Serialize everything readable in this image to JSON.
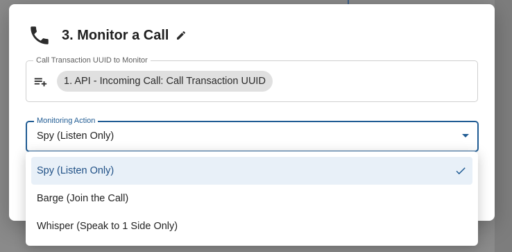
{
  "dialog": {
    "title": "3. Monitor a Call",
    "icons": {
      "header": "phone-icon",
      "edit": "pencil-icon",
      "add": "playlist-add-icon",
      "check": "check-icon"
    }
  },
  "uuid_field": {
    "label": "Call Transaction UUID to Monitor",
    "chip": "1. API - Incoming Call: Call Transaction UUID"
  },
  "action_field": {
    "label": "Monitoring Action",
    "value": "Spy (Listen Only)"
  },
  "menu": {
    "options": [
      {
        "label": "Spy (Listen Only)",
        "selected": true
      },
      {
        "label": "Barge (Join the Call)",
        "selected": false
      },
      {
        "label": "Whisper (Speak to 1 Side Only)",
        "selected": false
      }
    ]
  },
  "colors": {
    "accent": "#1f5b93",
    "selected_bg": "#e8f0f8",
    "chip_bg": "#e0e0e0"
  }
}
